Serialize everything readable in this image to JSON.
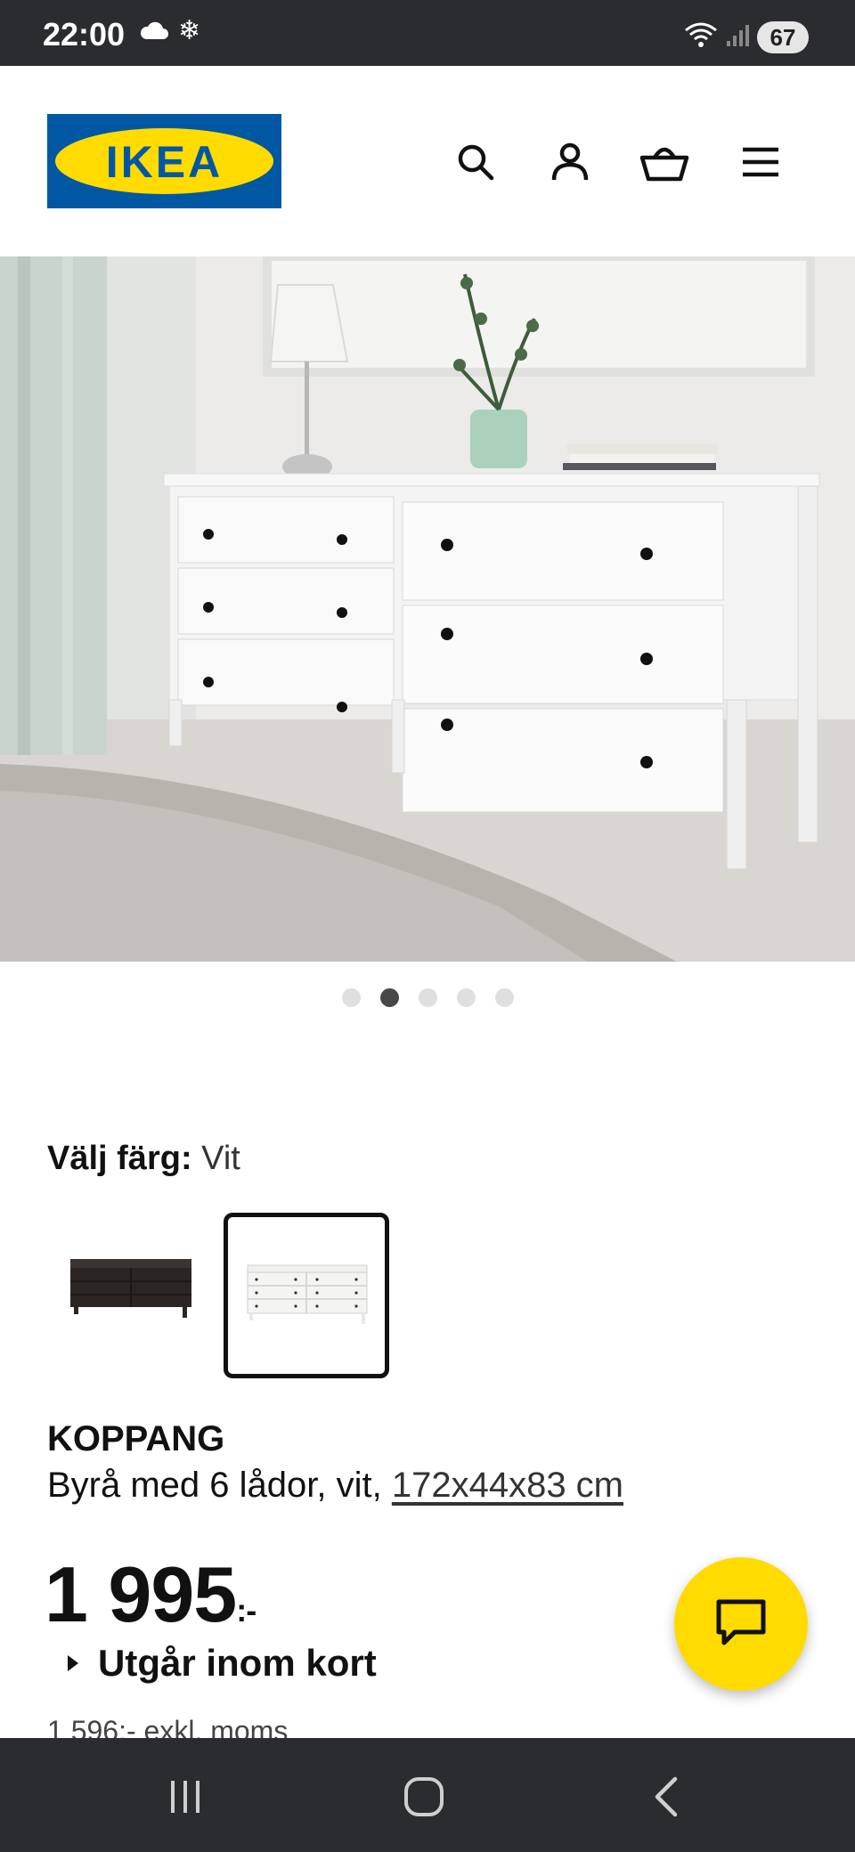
{
  "status_bar": {
    "time": "22:00",
    "battery": "67",
    "icons": [
      "cloud-icon",
      "snowflake-icon",
      "wifi-icon",
      "signal-icon"
    ]
  },
  "header": {
    "logo_text": "IKEA",
    "icons": [
      "search-icon",
      "user-icon",
      "basket-icon",
      "menu-icon"
    ],
    "brand_colors": {
      "blue": "#0058a3",
      "yellow": "#ffdb00"
    }
  },
  "gallery": {
    "image_count": 5,
    "active_index": 1
  },
  "color_select": {
    "label": "Välj färg:",
    "value": "Vit",
    "options": [
      {
        "name": "dark-brown",
        "color": "#2b2624",
        "selected": false
      },
      {
        "name": "white",
        "color": "#f2f2f0",
        "selected": true
      }
    ]
  },
  "product": {
    "name": "KOPPANG",
    "description": "Byrå med 6 lådor, vit, ",
    "dimensions": "172x44x83 cm",
    "price": "1 995",
    "price_suffix": ":-",
    "availability": "Utgår inom kort",
    "price_ex_vat": "1 596:- exkl. moms"
  },
  "chat_button": {
    "icon": "chat-icon",
    "color": "#ffdb00"
  },
  "nav_bar": {
    "icons": [
      "recent-apps-icon",
      "home-icon",
      "back-icon"
    ]
  }
}
